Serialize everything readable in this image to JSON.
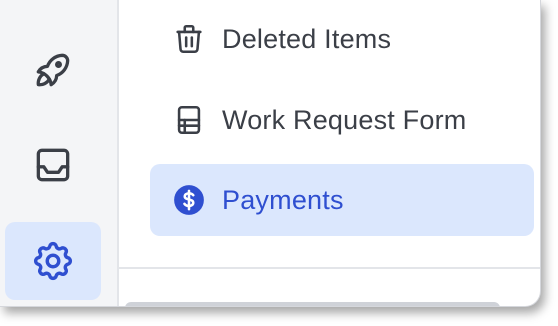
{
  "rail": {
    "items": [
      {
        "name": "rocket",
        "icon": "rocket-icon",
        "active": false
      },
      {
        "name": "inbox",
        "icon": "inbox-icon",
        "active": false
      },
      {
        "name": "settings",
        "icon": "gear-icon",
        "active": true
      }
    ]
  },
  "menu": {
    "items": [
      {
        "label": "Deleted Items",
        "icon": "trash-icon",
        "active": false
      },
      {
        "label": "Work Request Form",
        "icon": "form-icon",
        "active": false
      },
      {
        "label": "Payments",
        "icon": "dollar-circle-icon",
        "active": true
      }
    ]
  },
  "colors": {
    "accent": "#2f4fd0",
    "active_bg": "#dbe7fd",
    "icon_gray": "#3b3f47"
  }
}
